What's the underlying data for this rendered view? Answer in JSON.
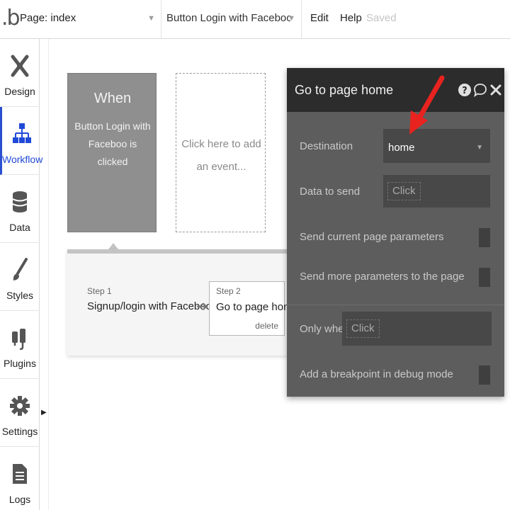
{
  "topbar": {
    "logo": ".b",
    "page_selector": "Page: index",
    "event_selector": "Button Login with Faceboo is clic...",
    "menu": {
      "edit": "Edit",
      "help": "Help",
      "status": "Saved"
    }
  },
  "sidebar": {
    "items": [
      {
        "label": "Design",
        "icon": "design-icon",
        "active": false
      },
      {
        "label": "Workflow",
        "icon": "workflow-icon",
        "active": true
      },
      {
        "label": "Data",
        "icon": "database-icon",
        "active": false
      },
      {
        "label": "Styles",
        "icon": "brush-icon",
        "active": false
      },
      {
        "label": "Plugins",
        "icon": "plug-icon",
        "active": false
      },
      {
        "label": "Settings",
        "icon": "gear-icon",
        "active": false
      },
      {
        "label": "Logs",
        "icon": "document-icon",
        "active": false
      }
    ]
  },
  "workflow": {
    "when_title": "When",
    "when_event": "Button Login with Faceboo is clicked",
    "add_event_text": "Click here to add an event...",
    "steps": [
      {
        "number": "Step 1",
        "name": "Signup/login with Facebook"
      },
      {
        "number": "Step 2",
        "name": "Go to page home",
        "delete_label": "delete"
      }
    ]
  },
  "property_editor": {
    "title": "Go to page home",
    "rows": {
      "destination_label": "Destination",
      "destination_value": "home",
      "data_to_send_label": "Data to send",
      "data_to_send_placeholder": "Click",
      "send_current_params_label": "Send current page parameters",
      "send_more_params_label": "Send more parameters to the page",
      "only_when_label": "Only when",
      "only_when_placeholder": "Click",
      "breakpoint_label": "Add a breakpoint in debug mode"
    }
  },
  "colors": {
    "accent": "#1f49d6",
    "panel_bg": "#5d5d5d",
    "panel_header": "#2c2c2c",
    "annotation_arrow": "#e8231f"
  }
}
